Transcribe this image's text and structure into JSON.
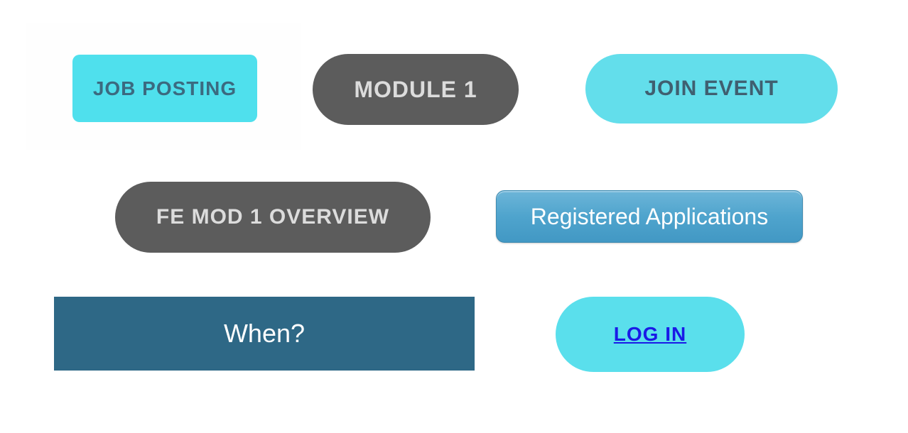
{
  "buttons": {
    "job_posting": "JOB POSTING",
    "module1": "MODULE 1",
    "join_event": "JOIN EVENT",
    "fe_overview": "FE MOD 1 OVERVIEW",
    "registered": "Registered Applications",
    "when": "When?",
    "login": "LOG IN"
  }
}
